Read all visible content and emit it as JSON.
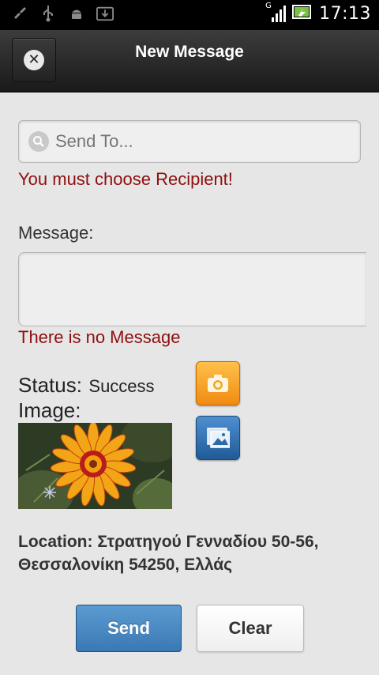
{
  "status_bar": {
    "time": "17:13",
    "network_label": "G",
    "icons": [
      "brush-icon",
      "usb-icon",
      "android-icon",
      "download-icon",
      "signal-icon",
      "battery-charging-icon"
    ]
  },
  "header": {
    "title": "New Message",
    "close_icon": "close-icon"
  },
  "recipient": {
    "placeholder": "Send To...",
    "value": "",
    "error": "You must choose Recipient!"
  },
  "message": {
    "label": "Message:",
    "value": "",
    "error": "There is no Message"
  },
  "status": {
    "label": "Status:",
    "value": "Success"
  },
  "image": {
    "label": "Image:",
    "description_icon": "flower-photo"
  },
  "attachments": {
    "camera_icon": "camera-icon",
    "gallery_icon": "gallery-icon"
  },
  "location": {
    "text": "Location: Στρατηγού Γενναδίου 50-56, Θεσσαλονίκη 54250, Ελλάς"
  },
  "actions": {
    "send_label": "Send",
    "clear_label": "Clear"
  },
  "colors": {
    "error": "#8e0f0f",
    "send_button": "#3a78b4",
    "header": "#1a1a1a"
  }
}
